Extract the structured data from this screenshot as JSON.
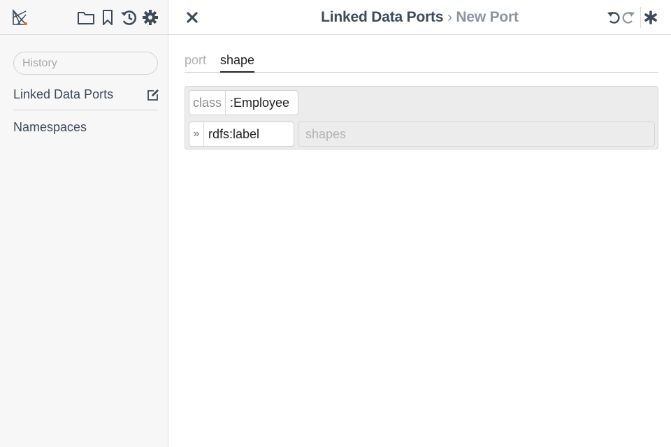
{
  "colors": {
    "text": "#3d4a59",
    "muted": "#8c959f",
    "sidebar_bg": "#f7f7f7",
    "panel_bg": "#ececec"
  },
  "toolbar": {
    "logo_icon": "app-logo",
    "icons": [
      "folder-icon",
      "bookmark-icon",
      "history-icon",
      "gear-icon"
    ]
  },
  "sidebar": {
    "search": {
      "placeholder": "History",
      "value": ""
    },
    "items": [
      {
        "label": "Linked Data Ports",
        "icon": "edit-icon"
      },
      {
        "label": "Namespaces"
      }
    ]
  },
  "header": {
    "breadcrumb": {
      "parent": "Linked Data Ports",
      "separator": "›",
      "current": "New Port"
    },
    "icons": [
      "close-icon",
      "undo-icon",
      "redo-icon",
      "asterisk-icon"
    ]
  },
  "tabs": [
    {
      "label": "port",
      "active": false
    },
    {
      "label": "shape",
      "active": true
    }
  ],
  "shape": {
    "class_label": "class",
    "class_value": ":Employee",
    "expand_symbol": "»",
    "property_value": "rdfs:label",
    "shapes_placeholder": "shapes",
    "shapes_value": ""
  }
}
